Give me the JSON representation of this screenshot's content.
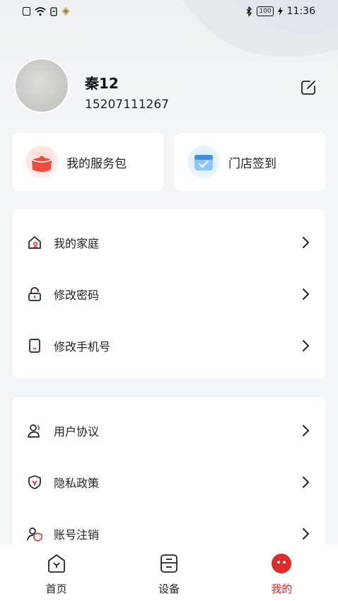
{
  "status_bar": {
    "time": "11:36",
    "battery": "100"
  },
  "profile": {
    "name": "秦12",
    "phone": "15207111267"
  },
  "quick_cards": [
    {
      "label": "我的服务包",
      "icon": "service-package-icon"
    },
    {
      "label": "门店签到",
      "icon": "store-checkin-icon"
    }
  ],
  "menu_group_1": [
    {
      "label": "我的家庭",
      "icon": "home-icon"
    },
    {
      "label": "修改密码",
      "icon": "lock-icon"
    },
    {
      "label": "修改手机号",
      "icon": "phone-icon"
    }
  ],
  "menu_group_2": [
    {
      "label": "用户协议",
      "icon": "user-agreement-icon"
    },
    {
      "label": "隐私政策",
      "icon": "privacy-shield-icon"
    },
    {
      "label": "账号注销",
      "icon": "account-cancel-icon"
    }
  ],
  "tabs": [
    {
      "label": "首页",
      "icon": "home-tab-icon",
      "active": false
    },
    {
      "label": "设备",
      "icon": "device-tab-icon",
      "active": false
    },
    {
      "label": "我的",
      "icon": "profile-tab-icon",
      "active": true
    }
  ],
  "colors": {
    "accent": "#e02a2a",
    "background": "#f4f5f7"
  }
}
